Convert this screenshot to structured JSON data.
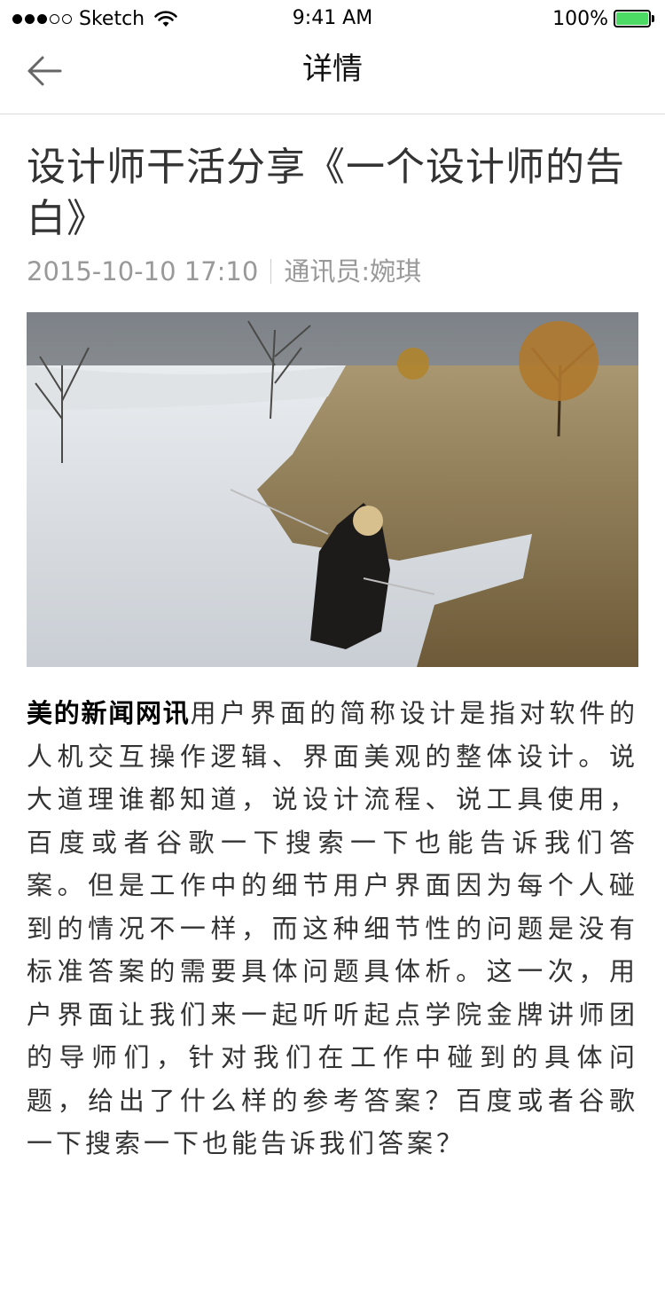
{
  "status_bar": {
    "carrier": "Sketch",
    "time": "9:41 AM",
    "battery": "100%",
    "battery_color": "#4cd964",
    "signal_bars_filled": 3,
    "signal_bars_total": 5
  },
  "nav": {
    "title": "详情",
    "back_icon": "back-arrow-icon"
  },
  "article": {
    "title": "设计师干活分享《一个设计师的告白》",
    "date": "2015-10-10 17:10",
    "author": "通讯员:婉琪",
    "image_icon": "landscape-photo",
    "lead": "美的新闻网讯",
    "body": "用户界面的简称设计是指对软件的人机交互操作逻辑、界面美观的整体设计。说大道理谁都知道，说设计流程、说工具使用，百度或者谷歌一下搜索一下也能告诉我们答案。但是工作中的细节用户界面因为每个人碰到的情况不一样，而这种细节性的问题是没有标准答案的需要具体问题具体析。这一次，用户界面让我们来一起听听起点学院金牌讲师团的导师们，针对我们在工作中碰到的具体问题，给出了什么样的参考答案？百度或者谷歌一下搜索一下也能告诉我们答案？"
  }
}
